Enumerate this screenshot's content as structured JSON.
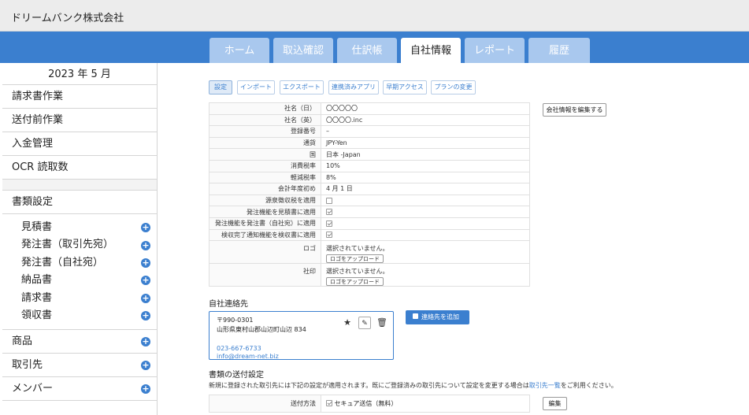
{
  "header": {
    "company_name": "ドリームバンク株式会社"
  },
  "tabs": [
    {
      "label": "ホーム"
    },
    {
      "label": "取込確認"
    },
    {
      "label": "仕訳帳"
    },
    {
      "label": "自社情報"
    },
    {
      "label": "レポート"
    },
    {
      "label": "履歴"
    }
  ],
  "sidebar": {
    "period": "2023 年 5 月",
    "top_items": [
      {
        "label": "請求書作業"
      },
      {
        "label": "送付前作業"
      },
      {
        "label": "入金管理"
      },
      {
        "label": "OCR 読取数"
      }
    ],
    "doc_settings_label": "書類設定",
    "doc_items": [
      {
        "label": "見積書"
      },
      {
        "label": "発注書（取引先宛）"
      },
      {
        "label": "発注書（自社宛）"
      },
      {
        "label": "納品書"
      },
      {
        "label": "請求書"
      },
      {
        "label": "領収書"
      }
    ],
    "bottom_items": [
      {
        "label": "商品"
      },
      {
        "label": "取引先"
      },
      {
        "label": "メンバー"
      }
    ]
  },
  "subtabs": [
    {
      "label": "設定"
    },
    {
      "label": "インポート"
    },
    {
      "label": "エクスポート"
    },
    {
      "label": "連携済みアプリ"
    },
    {
      "label": "早期アクセス"
    },
    {
      "label": "プランの変更"
    }
  ],
  "company_info": {
    "edit_button": "会社情報を編集する",
    "rows": [
      {
        "label": "社名（日）",
        "value": "〇〇〇〇〇"
      },
      {
        "label": "社名（英）",
        "value": "〇〇〇〇.inc"
      },
      {
        "label": "登録番号",
        "value": "–"
      },
      {
        "label": "通貨",
        "value": "JPY-Yen"
      },
      {
        "label": "国",
        "value": "日本 -Japan"
      },
      {
        "label": "消費税率",
        "value": "10%"
      },
      {
        "label": "軽減税率",
        "value": "8%"
      },
      {
        "label": "会計年度初め",
        "value": "4 月 1 日"
      },
      {
        "label": "源泉徴収税を適用",
        "value": ""
      },
      {
        "label": "発注機能を見積書に適用",
        "value": ""
      },
      {
        "label": "発注機能を発注書（自社宛）に適用",
        "value": ""
      },
      {
        "label": "検収完了通知機能を検収書に適用",
        "value": ""
      }
    ],
    "logo_label": "ロゴ",
    "logo_status": "選択されていません。",
    "logo_upload": "ロゴをアップロード",
    "seal_label": "社印",
    "seal_status": "選択されていません。",
    "seal_upload": "ロゴをアップロード"
  },
  "contacts": {
    "title": "自社連絡先",
    "zip": "〒990-0301",
    "address": "山形県東村山郡山辺町山辺 834",
    "phone": "023-667-6733",
    "email": "info@dream-net.biz",
    "add_button": "連絡先を追加",
    "icons": {
      "favorite": "star-icon",
      "edit": "pencil-icon",
      "delete": "trash-icon"
    }
  },
  "send_settings": {
    "title": "書類の送付設定",
    "desc_before": "新規に登録された取引先には下記の設定が適用されます。既にご登録済みの取引先について設定を変更する場合は",
    "desc_link": "取引先一覧",
    "desc_after": "をご利用ください。",
    "row_label": "送付方法",
    "row_value": "セキュア送信（無料）",
    "edit_button": "編集"
  },
  "colors": {
    "accent": "#3b7fcf",
    "tab_inactive": "#a9c8ee",
    "topbar": "#ececec"
  }
}
